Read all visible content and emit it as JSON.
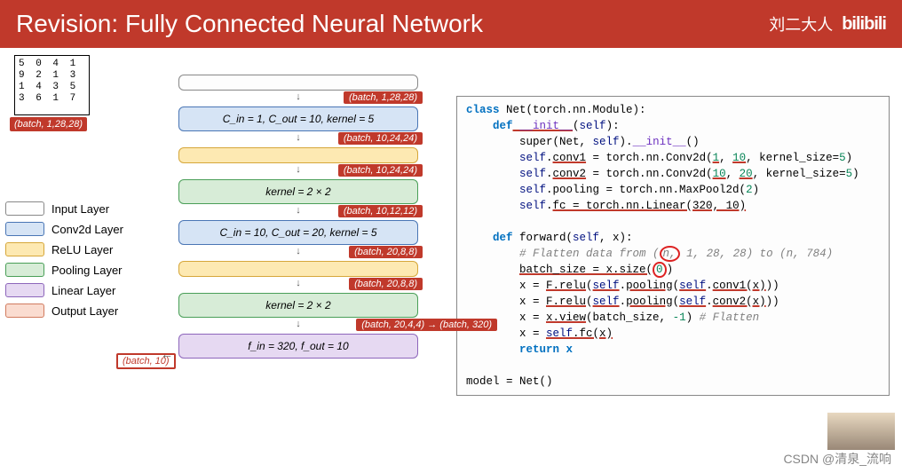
{
  "header": {
    "title": "Revision: Fully Connected Neural Network",
    "author": "刘二大人",
    "logo": "bilibili"
  },
  "legend": [
    {
      "class": "sw-input",
      "label": "Input Layer"
    },
    {
      "class": "sw-conv",
      "label": "Conv2d Layer"
    },
    {
      "class": "sw-relu",
      "label": "ReLU Layer"
    },
    {
      "class": "sw-pool",
      "label": "Pooling Layer"
    },
    {
      "class": "sw-linear",
      "label": "Linear Layer"
    },
    {
      "class": "sw-output",
      "label": "Output Layer"
    }
  ],
  "digits": "5 0 4 1\n9 2 1 3\n1 4 3 5\n3 6 1 7",
  "digits_shape": "(batch, 1,28,28)",
  "blocks": [
    {
      "style": "sw-input",
      "text": "",
      "shape": "(batch, 1,28,28)",
      "slim": true
    },
    {
      "style": "sw-conv",
      "text": "C_in = 1, C_out = 10, kernel = 5",
      "shape": "(batch, 10,24,24)"
    },
    {
      "style": "sw-relu",
      "text": "",
      "shape": "(batch, 10,24,24)",
      "slim": true
    },
    {
      "style": "sw-pool",
      "text": "kernel = 2 × 2",
      "shape": "(batch, 10,12,12)"
    },
    {
      "style": "sw-conv",
      "text": "C_in = 10, C_out = 20, kernel = 5",
      "shape": "(batch, 20,8,8)"
    },
    {
      "style": "sw-relu",
      "text": "",
      "shape": "(batch, 20,8,8)",
      "slim": true
    },
    {
      "style": "sw-pool",
      "text": "kernel = 2 × 2",
      "shape": "(batch, 20,4,4) → (batch, 320)",
      "wide": true
    },
    {
      "style": "sw-linear",
      "text": "f_in = 320, f_out = 10",
      "shape": ""
    }
  ],
  "out_shape": "(batch, 10)",
  "code": {
    "l01a": "class",
    "l01b": " Net(torch.nn.Module):",
    "l02a": "    def",
    "l02b": " __init__",
    "l02c": "(",
    "l02d": "self",
    "l02e": "):",
    "l03a": "        super(Net, ",
    "l03b": "self",
    "l03c": ").",
    "l03d": "__init__",
    "l03e": "()",
    "l04a": "        self",
    "l04b": ".",
    "l04c": "conv1",
    "l04d": " = torch.nn.Conv2d(",
    "l04e": "1",
    "l04f": ", ",
    "l04g": "10",
    "l04h": ", kernel_size=",
    "l04i": "5",
    "l04j": ")",
    "l05a": "        self",
    "l05b": ".",
    "l05c": "conv2",
    "l05d": " = torch.nn.Conv2d(",
    "l05e": "10",
    "l05f": ", ",
    "l05g": "20",
    "l05h": ", kernel_size=",
    "l05i": "5",
    "l05j": ")",
    "l06a": "        self",
    "l06b": ".pooling = torch.nn.MaxPool2d(",
    "l06c": "2",
    "l06d": ")",
    "l07a": "        self",
    "l07b": ".",
    "l07c": "fc = torch.nn.Linear(320, 10)",
    "l08": "",
    "l09a": "    def",
    "l09b": " forward(",
    "l09c": "self",
    "l09d": ", x):",
    "l10a": "        ",
    "l10b": "# Flatten data from (",
    "l10c": "n,",
    "l10d": " 1, 28, 28) to (n, 784)",
    "l11a": "        ",
    "l11b": "batch_size = x.size(",
    "l11c": "0",
    "l11d": ")",
    "l12a": "        x = ",
    "l12b": "F.relu",
    "l12c": "(",
    "l12d": "self",
    "l12e": ".",
    "l12f": "pooling",
    "l12g": "(",
    "l12h": "self",
    "l12i": ".",
    "l12j": "conv1(x)",
    "l12k": "))",
    "l13a": "        x = ",
    "l13b": "F.relu",
    "l13c": "(",
    "l13d": "self",
    "l13e": ".",
    "l13f": "pooling",
    "l13g": "(",
    "l13h": "self",
    "l13i": ".",
    "l13j": "conv2(x)",
    "l13k": "))",
    "l14a": "        x = ",
    "l14b": "x.view",
    "l14c": "(batch_size, ",
    "l14d": "-1",
    "l14e": ") ",
    "l14f": "# Flatten",
    "l15a": "        x = ",
    "l15b": "self",
    "l15c": ".fc(x)",
    "l16": "        return x",
    "l17": "",
    "l18": "model = Net()"
  },
  "watermark": "CSDN @清泉_流响"
}
